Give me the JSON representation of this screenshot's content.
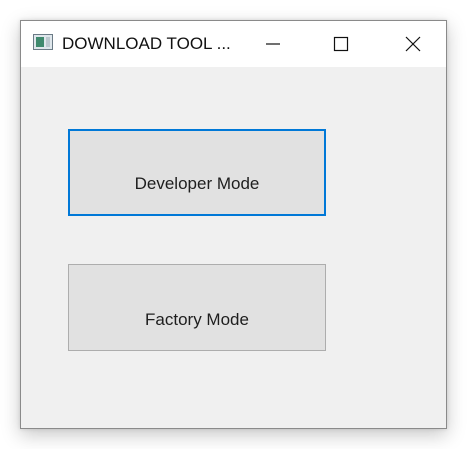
{
  "window": {
    "title": "DOWNLOAD TOOL ...",
    "controls": {
      "minimize_icon": "minimize-icon",
      "maximize_icon": "maximize-icon",
      "close_icon": "close-icon"
    }
  },
  "main": {
    "developer_mode_label": "Developer Mode",
    "factory_mode_label": "Factory Mode",
    "focused_button": "developer_mode"
  },
  "colors": {
    "focus_border": "#0078d7",
    "button_face": "#e1e1e1",
    "window_background": "#f0f0f0",
    "titlebar_background": "#ffffff"
  }
}
